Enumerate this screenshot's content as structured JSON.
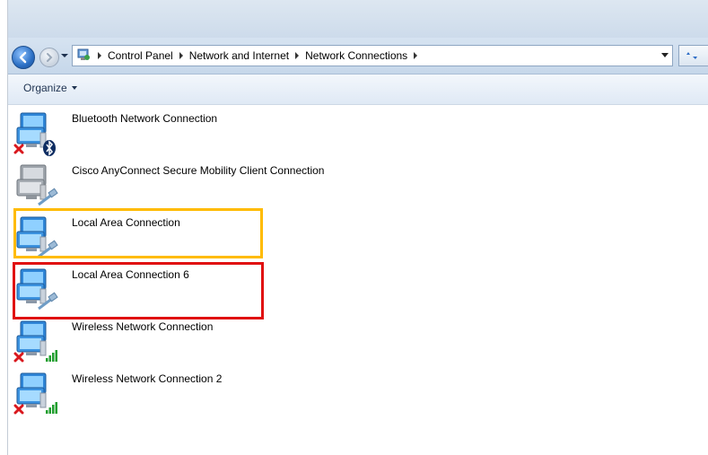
{
  "window": {
    "breadcrumbs": [
      "Control Panel",
      "Network and Internet",
      "Network Connections"
    ]
  },
  "toolbar": {
    "organize_label": "Organize"
  },
  "connections": [
    {
      "label": "Bluetooth Network Connection",
      "icon": "network-computer-icon",
      "status": "disabled",
      "badge": "bluetooth-icon"
    },
    {
      "label": "Cisco AnyConnect Secure Mobility Client Connection",
      "icon": "network-computer-icon",
      "status": "disabled",
      "badge": "ethernet-cable-icon"
    },
    {
      "label": "Local Area Connection",
      "icon": "network-computer-icon",
      "status": "enabled",
      "badge": "ethernet-cable-icon"
    },
    {
      "label": "Local Area Connection 6",
      "icon": "network-computer-icon",
      "status": "enabled",
      "badge": "ethernet-cable-icon"
    },
    {
      "label": "Wireless Network Connection",
      "icon": "network-computer-icon",
      "status": "disconnected",
      "badge": "signal-bars-icon"
    },
    {
      "label": "Wireless Network Connection 2",
      "icon": "network-computer-icon",
      "status": "disconnected",
      "badge": "signal-bars-icon"
    }
  ],
  "highlights": {
    "orange": "#ffbb00",
    "red": "#e01010"
  }
}
